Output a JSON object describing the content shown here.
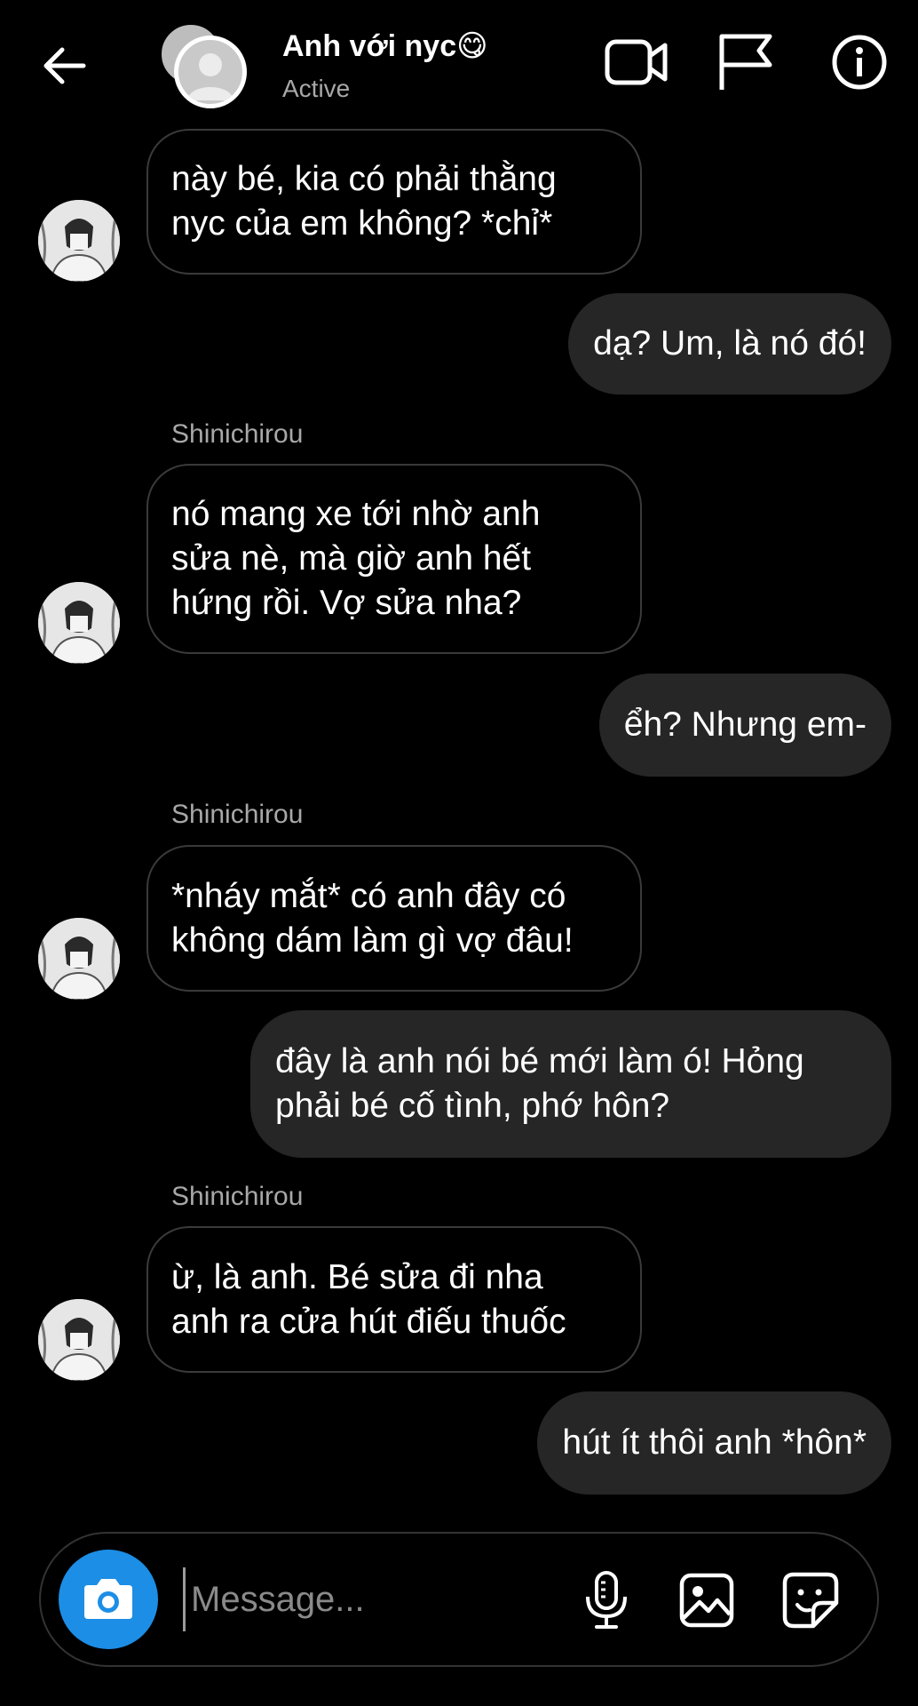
{
  "header": {
    "title": "Anh với nyc😋",
    "status": "Active",
    "icons": [
      "back-arrow-icon",
      "video-call-icon",
      "flag-icon",
      "info-icon"
    ]
  },
  "messages": [
    {
      "id": 1,
      "direction": "incoming",
      "sender": "",
      "lines": [
        "này bé, kia có phải thằng",
        "nyc của em không? *chỉ*"
      ]
    },
    {
      "id": 2,
      "direction": "outgoing",
      "lines": [
        "dạ? Um, là nó đó!"
      ]
    },
    {
      "id": 3,
      "direction": "incoming",
      "sender": "Shinichirou",
      "lines": [
        "nó mang xe tới nhờ anh",
        "sửa nè, mà giờ anh hết",
        "hứng rồi. Vợ sửa nha?"
      ]
    },
    {
      "id": 4,
      "direction": "outgoing",
      "lines": [
        "ểh? Nhưng em-"
      ]
    },
    {
      "id": 5,
      "direction": "incoming",
      "sender": "Shinichirou",
      "lines": [
        "*nháy mắt* có anh đây có",
        "không dám làm gì vợ đâu!"
      ]
    },
    {
      "id": 6,
      "direction": "outgoing",
      "lines": [
        "đây là anh nói bé mới làm ó! Hỏng",
        "phải bé cố tình, phớ hôn?"
      ]
    },
    {
      "id": 7,
      "direction": "incoming",
      "sender": "Shinichirou",
      "lines": [
        "ừ, là anh. Bé sửa đi nha",
        "anh ra cửa hút điếu thuốc"
      ]
    },
    {
      "id": 8,
      "direction": "outgoing",
      "lines": [
        "hút ít thôi anh *hôn*"
      ]
    }
  ],
  "composer": {
    "placeholder": "Message...",
    "icons": [
      "camera-icon",
      "microphone-icon",
      "photo-icon",
      "sticker-icon"
    ],
    "camera_color": "#1c8ee6"
  },
  "colors": {
    "background": "#000000",
    "outgoing_bubble": "#262626",
    "incoming_border": "#3a3a3a",
    "secondary_text": "#a8a8a8"
  }
}
